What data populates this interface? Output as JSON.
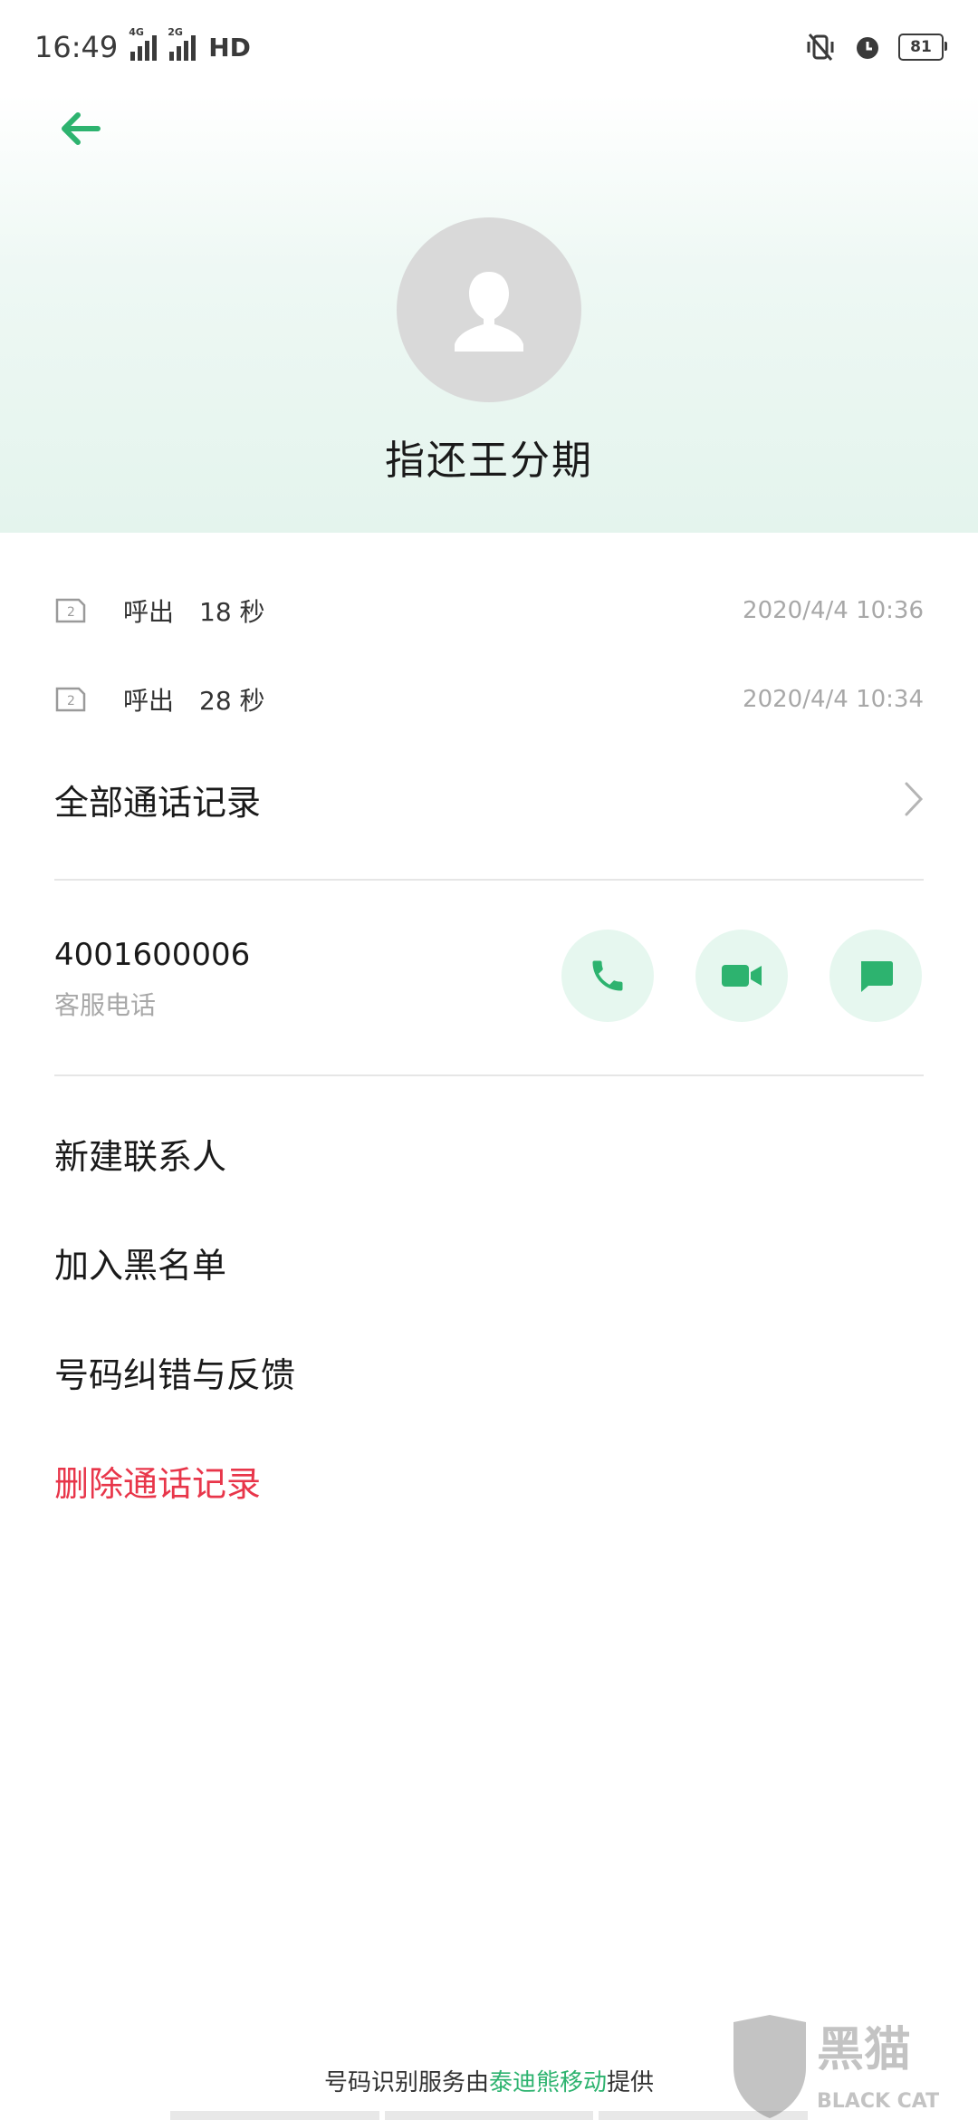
{
  "status_bar": {
    "time": "16:49",
    "net1": "4G",
    "net2": "2G",
    "hd": "HD",
    "battery": "81"
  },
  "contact": {
    "name": "指还王分期"
  },
  "calls": [
    {
      "type": "呼出",
      "duration": "18 秒",
      "time": "2020/4/4 10:36",
      "sim": "2"
    },
    {
      "type": "呼出",
      "duration": "28 秒",
      "time": "2020/4/4 10:34",
      "sim": "2"
    }
  ],
  "all_records_label": "全部通话记录",
  "number": {
    "value": "4001600006",
    "label": "客服电话"
  },
  "menu": {
    "new_contact": "新建联系人",
    "blacklist": "加入黑名单",
    "feedback": "号码纠错与反馈",
    "delete_records": "删除通话记录"
  },
  "footer": {
    "prefix": "号码识别服务由",
    "provider": "泰迪熊移动",
    "suffix": "提供"
  },
  "watermark": {
    "text": "黑猫",
    "sub": "BLACK CAT"
  },
  "colors": {
    "accent": "#2db36f",
    "danger": "#e8364a",
    "action_bg": "#e6f7ef"
  },
  "icons": {
    "back": "arrow-left-icon",
    "call": "phone-icon",
    "video": "video-camera-icon",
    "message": "chat-bubble-icon",
    "chevron": "chevron-right-icon",
    "sim": "sim-card-icon",
    "avatar": "person-icon"
  }
}
